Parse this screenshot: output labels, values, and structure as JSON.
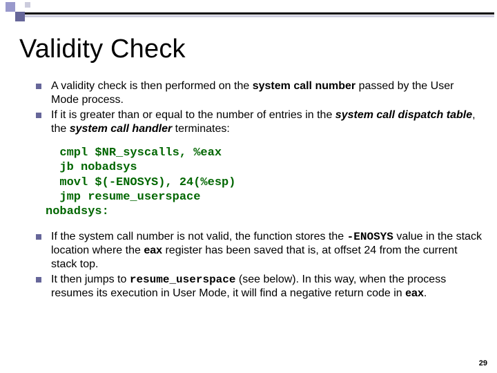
{
  "title": "Validity Check",
  "bullets_top": [
    {
      "prefix": "A validity check is then performed on the ",
      "bold1": "system call number ",
      "mid": "passed by the User Mode process.",
      "suffix": ""
    },
    {
      "prefix": "If it is greater than or equal to the number of entries in the ",
      "bold1": "system call dispatch table",
      "mid": ", the ",
      "bold2": "system call handler",
      "suffix": " terminates:"
    }
  ],
  "code": "  cmpl $NR_syscalls, %eax\n  jb nobadsys\n  movl $(-ENOSYS), 24(%esp)\n  jmp resume_userspace\nnobadsys:",
  "bullets_bottom": [
    {
      "t0": "If the system call number is not valid, the function stores the ",
      "c0": "-ENOSYS",
      "t1": " value in the stack location where the ",
      "b1": "eax",
      "t2": " register has been saved that is, at offset 24 from the current stack top."
    },
    {
      "t0": "It then jumps to ",
      "c0": "resume_userspace",
      "t1": " (see below). In this way, when the process resumes its execution in User Mode, it will find a negative return code in ",
      "b1": "eax",
      "t2": "."
    }
  ],
  "page_number": "29"
}
